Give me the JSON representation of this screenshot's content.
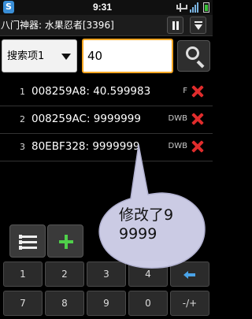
{
  "status_bar": {
    "time": "9:31",
    "app_icon_letter": "S",
    "icons": [
      "usb-icon",
      "signal-icon",
      "battery-icon"
    ]
  },
  "title_bar": {
    "title": "八门神器: 水果忍者[3396]",
    "buttons": [
      "pause-icon",
      "menu-dropdown-icon"
    ]
  },
  "search": {
    "type_label": "搜索项1",
    "value": "40"
  },
  "results": [
    {
      "index": "1",
      "text": "008259A8: 40.599983",
      "type": "F"
    },
    {
      "index": "2",
      "text": "008259AC: 9999999",
      "type": "DWB"
    },
    {
      "index": "3",
      "text": "80EBF328: 9999999",
      "type": "DWB"
    }
  ],
  "annotation": {
    "line1": "修改了9",
    "line2": "9999"
  },
  "toolbar": {
    "buttons": [
      "list-icon",
      "add-icon"
    ]
  },
  "keypad": {
    "row1": [
      "1",
      "2",
      "3",
      "4",
      "backspace-icon"
    ],
    "row2": [
      "7",
      "8",
      "9",
      "0",
      "-/+"
    ]
  },
  "colors": {
    "accent_orange": "#f5a623",
    "delete_red": "#e02c2c",
    "add_green": "#4fd04a",
    "bubble_fill": "#d4d4ee"
  }
}
